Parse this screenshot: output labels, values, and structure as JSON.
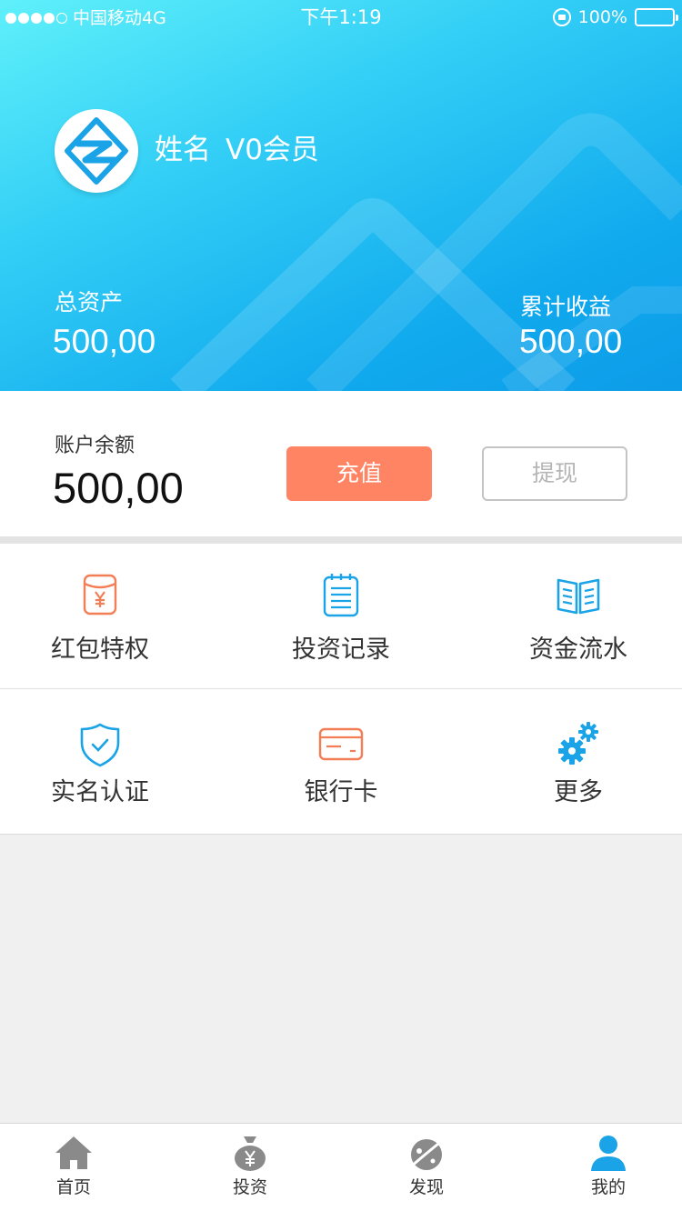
{
  "status_bar": {
    "carrier": "中国移动4G",
    "time": "下午1:19",
    "battery": "100%",
    "signal_bars": 4
  },
  "profile": {
    "name": "姓名",
    "level": "V0会员"
  },
  "summary": {
    "total_assets_label": "总资产",
    "total_assets_value": "500,00",
    "total_income_label": "累计收益",
    "total_income_value": "500,00"
  },
  "balance": {
    "label": "账户余额",
    "value": "500,00",
    "recharge_label": "充值",
    "withdraw_label": "提现"
  },
  "menu": [
    {
      "label": "红包特权",
      "icon": "red-envelope-icon"
    },
    {
      "label": "投资记录",
      "icon": "notepad-icon"
    },
    {
      "label": "资金流水",
      "icon": "open-book-icon"
    },
    {
      "label": "实名认证",
      "icon": "shield-check-icon"
    },
    {
      "label": "银行卡",
      "icon": "bank-card-icon"
    },
    {
      "label": "更多",
      "icon": "gears-icon"
    }
  ],
  "tabbar": {
    "items": [
      {
        "label": "首页",
        "icon": "home-icon"
      },
      {
        "label": "投资",
        "icon": "money-bag-icon"
      },
      {
        "label": "发现",
        "icon": "planet-icon"
      },
      {
        "label": "我的",
        "icon": "user-icon"
      }
    ],
    "active": "我的"
  },
  "colors": {
    "brand_blue": "#16a6ea",
    "accent_orange": "#ff8463",
    "header_gradient_start": "#5ff0fa",
    "header_gradient_end": "#0d9ce8"
  }
}
